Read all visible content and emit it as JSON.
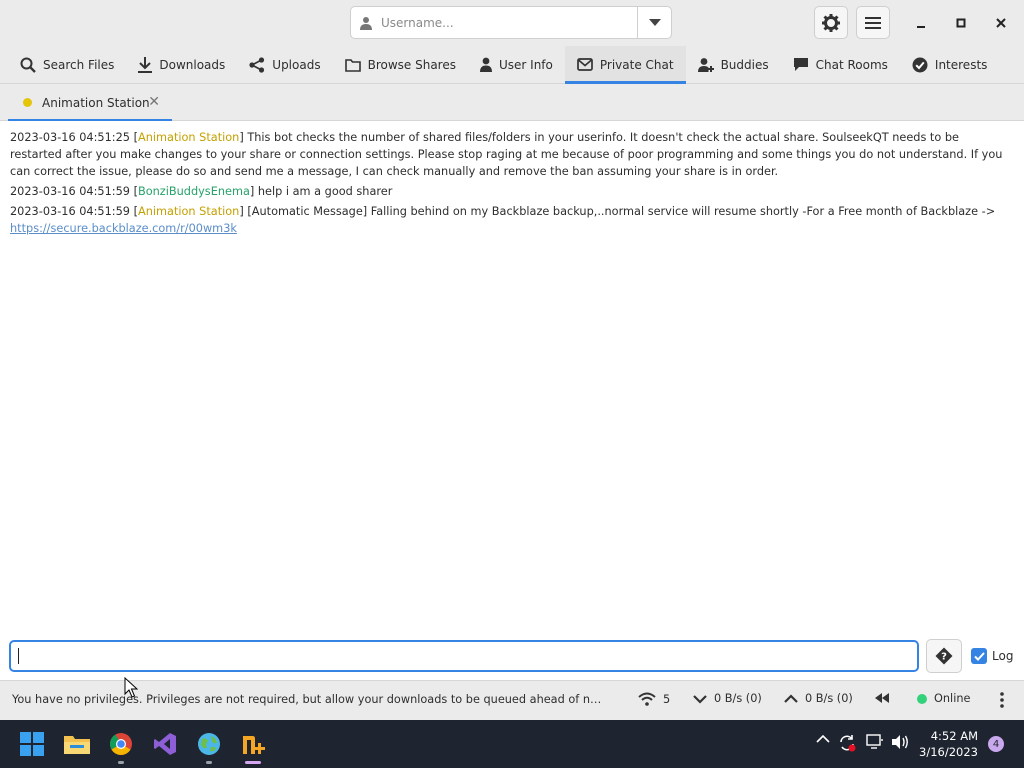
{
  "titlebar": {
    "username_placeholder": "Username...",
    "icons": [
      "user-icon",
      "chevron-down-icon",
      "gear-icon",
      "hamburger-menu-icon",
      "minimize-icon",
      "maximize-icon",
      "close-icon"
    ]
  },
  "main_tabs": [
    {
      "label": "Search Files",
      "icon": "search-icon"
    },
    {
      "label": "Downloads",
      "icon": "download-icon"
    },
    {
      "label": "Uploads",
      "icon": "share-icon"
    },
    {
      "label": "Browse Shares",
      "icon": "folder-icon"
    },
    {
      "label": "User Info",
      "icon": "user-icon"
    },
    {
      "label": "Private Chat",
      "icon": "envelope-icon",
      "active": true
    },
    {
      "label": "Buddies",
      "icon": "buddy-add-icon"
    },
    {
      "label": "Chat Rooms",
      "icon": "chat-bubble-icon"
    },
    {
      "label": "Interests",
      "icon": "check-circle-icon"
    }
  ],
  "sub_tab": {
    "label": "Animation Station",
    "status_color": "#e5c50a"
  },
  "messages": [
    {
      "timestamp": "2023-03-16 04:51:25",
      "user": "Animation Station",
      "text": "This bot checks the number of shared files/folders in your userinfo. It doesn't check the actual share. SoulseekQT needs to be restarted after you make changes to your share or connection settings. Please stop raging at me because of poor programming and some things you do not understand. If you can correct the issue, please do so and send me a message, I can check manually and remove the ban assuming your share is in order."
    },
    {
      "timestamp": "2023-03-16 04:51:59",
      "user": "BonziBuddysEnema",
      "text": "help i am a good sharer"
    },
    {
      "timestamp": "2023-03-16 04:51:59",
      "user": "Animation Station",
      "text": "[Automatic Message] Falling behind on my Backblaze backup,..normal service will resume shortly -For a Free month of Backblaze ->",
      "link": "https://secure.backblaze.com/r/00wm3k"
    }
  ],
  "composer": {
    "value": "",
    "log_label": "Log",
    "log_checked": true
  },
  "statusbar": {
    "message": "You have no privileges. Privileges are not required, but allow your downloads to be queued ahead of non-privil...",
    "connections": "5",
    "download_speed": "0 B/s (0)",
    "upload_speed": "0 B/s (0)",
    "status": "Online"
  },
  "taskbar": {
    "apps": [
      "windows-start-icon",
      "file-explorer-icon",
      "chrome-icon",
      "visual-studio-icon",
      "globe-app-icon",
      "nicotine-plus-icon"
    ],
    "time": "4:52 AM",
    "date": "3/16/2023",
    "notifications": "4"
  },
  "colors": {
    "accent": "#3584e4",
    "user_animation_station": "#c4a000",
    "user_bonzi": "#26a269",
    "online": "#33d17a"
  }
}
